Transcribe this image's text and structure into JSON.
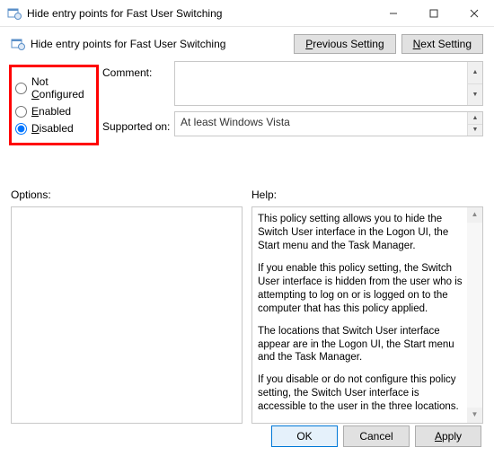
{
  "window": {
    "title": "Hide entry points for Fast User Switching",
    "header_title": "Hide entry points for Fast User Switching"
  },
  "nav": {
    "prev_pre": "",
    "prev_u": "P",
    "prev_post": "revious Setting",
    "next_pre": "",
    "next_u": "N",
    "next_post": "ext Setting"
  },
  "radios": {
    "nc_pre": "Not ",
    "nc_u": "C",
    "nc_post": "onfigured",
    "en_pre": "",
    "en_u": "E",
    "en_post": "nabled",
    "di_pre": "",
    "di_u": "D",
    "di_post": "isabled",
    "selected": "disabled"
  },
  "labels": {
    "comment": "Comment:",
    "supported": "Supported on:",
    "options": "Options:",
    "help": "Help:"
  },
  "supported_on": "At least Windows Vista",
  "help": {
    "p1": "This policy setting allows you to hide the Switch User interface in the Logon UI, the Start menu and the Task Manager.",
    "p2": "If you enable this policy setting, the Switch User interface is hidden from the user who is attempting to log on or is logged on to the computer that has this policy applied.",
    "p3": "The locations that Switch User interface appear are in the Logon UI, the Start menu and the Task Manager.",
    "p4": "If you disable or do not configure this policy setting, the Switch User interface is accessible to the user in the three locations."
  },
  "footer": {
    "ok": "OK",
    "cancel": "Cancel",
    "apply_pre": "",
    "apply_u": "A",
    "apply_post": "pply"
  }
}
